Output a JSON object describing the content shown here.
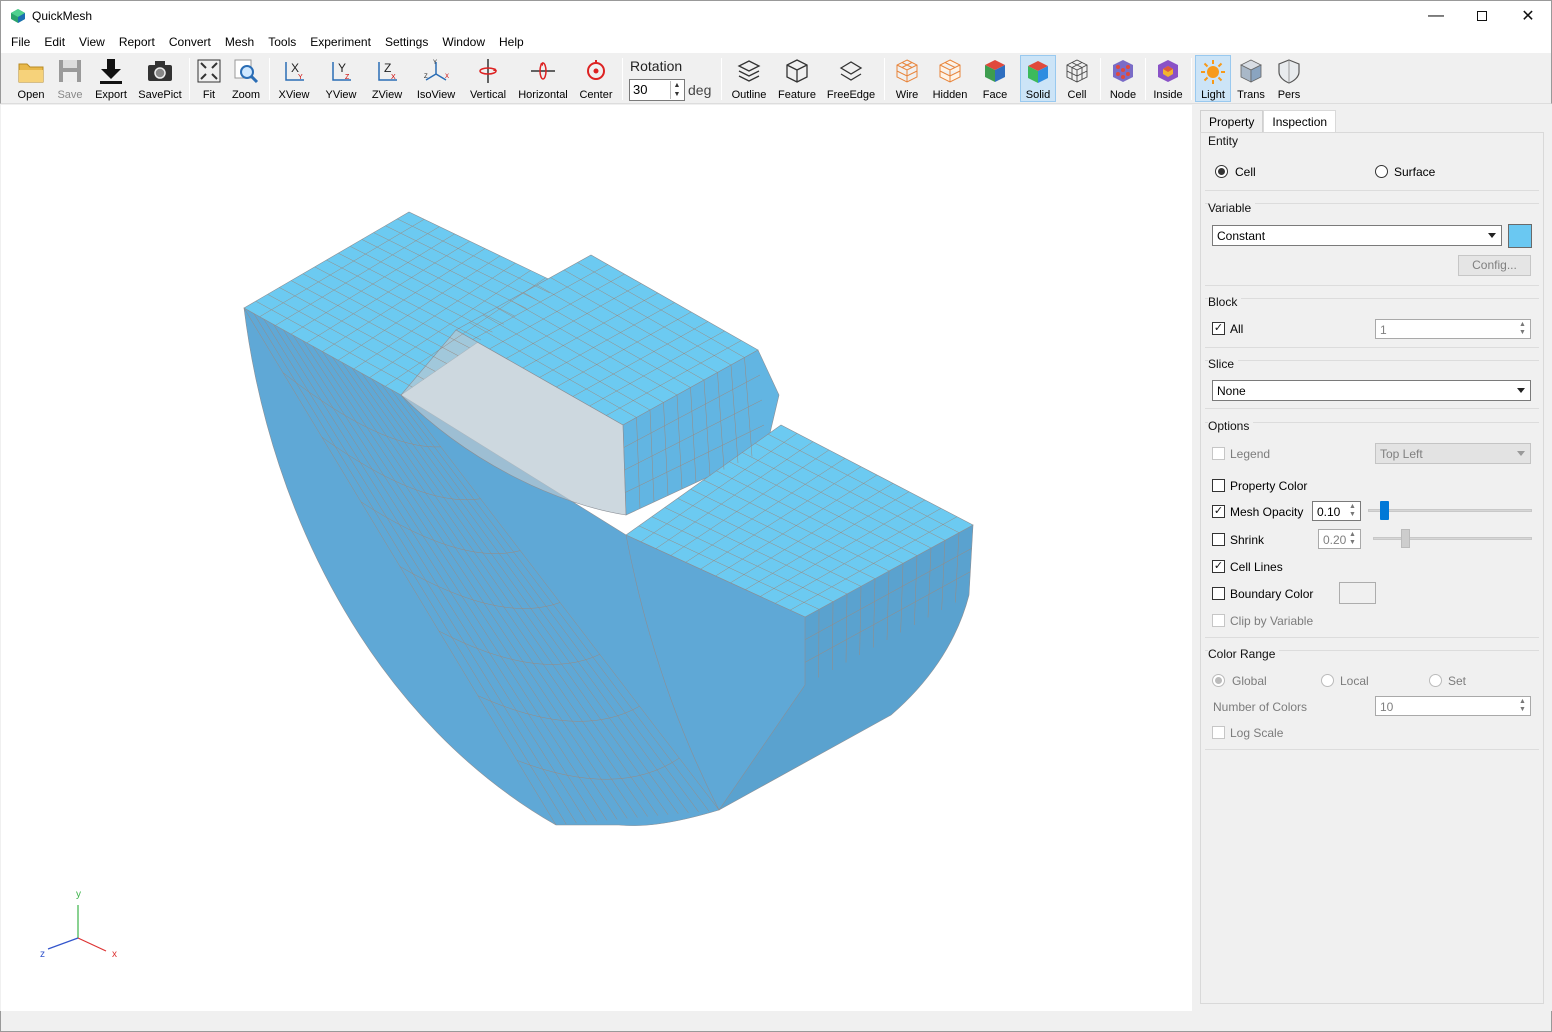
{
  "window": {
    "title": "QuickMesh",
    "controls": [
      "minimize-icon",
      "maximize-icon",
      "close-icon"
    ]
  },
  "menu": [
    "File",
    "Edit",
    "View",
    "Report",
    "Convert",
    "Mesh",
    "Tools",
    "Experiment",
    "Settings",
    "Window",
    "Help"
  ],
  "toolbar": {
    "open": "Open",
    "save": "Save",
    "export": "Export",
    "savepict": "SavePict",
    "fit": "Fit",
    "zoom": "Zoom",
    "xview": "XView",
    "yview": "YView",
    "zview": "ZView",
    "isoview": "IsoView",
    "vertical": "Vertical",
    "horizontal": "Horizontal",
    "center": "Center",
    "rotation_label": "Rotation",
    "rotation_value": "30",
    "rotation_unit": "deg",
    "outline": "Outline",
    "feature": "Feature",
    "freeedge": "FreeEdge",
    "wire": "Wire",
    "hidden": "Hidden",
    "face": "Face",
    "solid": "Solid",
    "cell": "Cell",
    "node": "Node",
    "inside": "Inside",
    "light": "Light",
    "trans": "Trans",
    "pers": "Pers",
    "active_tools": [
      "Solid",
      "Light"
    ],
    "disabled_tools": [
      "Save"
    ]
  },
  "axes": {
    "y": "y",
    "z": "z",
    "x": "x"
  },
  "colors": {
    "mesh_fill": "#6ac8f2",
    "mesh_line": "#9a8a80",
    "accent": "#0078d7"
  },
  "panel": {
    "tabs": [
      "Property",
      "Inspection"
    ],
    "selected_tab": "Inspection",
    "entity": {
      "title": "Entity",
      "options": [
        "Cell",
        "Surface"
      ],
      "selected": "Cell"
    },
    "variable": {
      "title": "Variable",
      "value": "Constant",
      "config": "Config..."
    },
    "block": {
      "title": "Block",
      "all_label": "All",
      "all_checked": true,
      "value": "1"
    },
    "slice": {
      "title": "Slice",
      "value": "None"
    },
    "options": {
      "title": "Options",
      "legend": "Legend",
      "legend_position": "Top Left",
      "property_color": "Property Color",
      "mesh_opacity": "Mesh Opacity",
      "mesh_opacity_value": "0.10",
      "mesh_opacity_slider": 0.1,
      "shrink": "Shrink",
      "shrink_value": "0.20",
      "shrink_slider": 0.2,
      "cell_lines": "Cell Lines",
      "boundary_color": "Boundary Color",
      "clip_by_variable": "Clip by Variable"
    },
    "color_range": {
      "title": "Color Range",
      "options": [
        "Global",
        "Local",
        "Set"
      ],
      "selected": "Global",
      "number_of_colors_label": "Number of Colors",
      "number_of_colors": "10",
      "log_scale": "Log Scale"
    }
  }
}
